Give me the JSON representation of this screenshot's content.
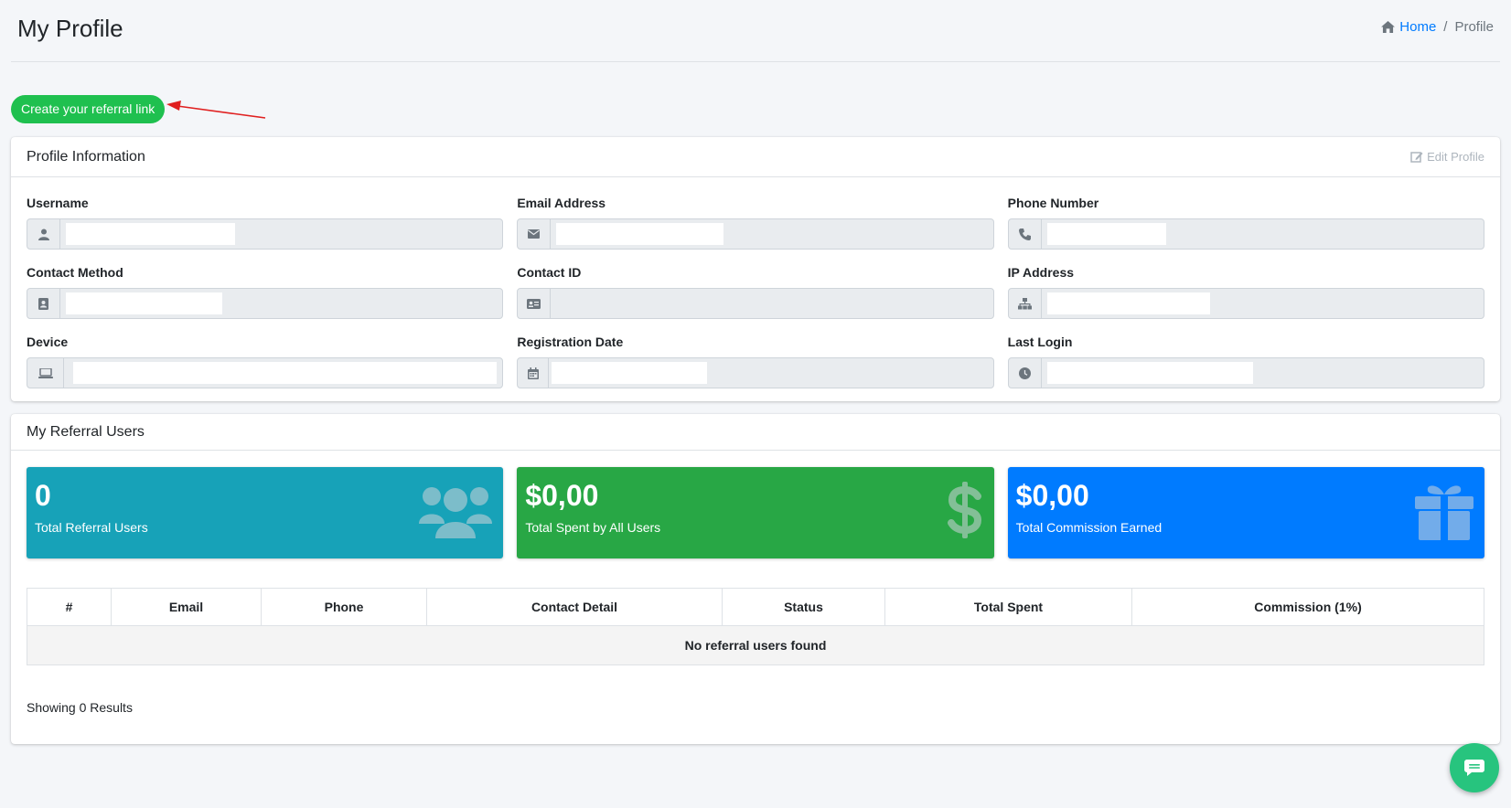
{
  "header": {
    "title": "My Profile",
    "breadcrumb": {
      "home": "Home",
      "separator": "/",
      "current": "Profile"
    }
  },
  "referral_button": {
    "label": "Create your referral link"
  },
  "profile_card": {
    "title": "Profile Information",
    "edit_label": "Edit Profile",
    "fields": {
      "username": {
        "label": "Username",
        "icon": "user-icon"
      },
      "email": {
        "label": "Email Address",
        "icon": "envelope-icon"
      },
      "phone": {
        "label": "Phone Number",
        "icon": "phone-icon"
      },
      "contact_method": {
        "label": "Contact Method",
        "icon": "address-book-icon"
      },
      "contact_id": {
        "label": "Contact ID",
        "icon": "id-card-icon"
      },
      "ip_address": {
        "label": "IP Address",
        "icon": "network-icon"
      },
      "device": {
        "label": "Device",
        "icon": "laptop-icon"
      },
      "registration_date": {
        "label": "Registration Date",
        "icon": "calendar-icon"
      },
      "last_login": {
        "label": "Last Login",
        "icon": "clock-icon"
      }
    }
  },
  "referral_card": {
    "title": "My Referral Users",
    "stats": [
      {
        "value": "0",
        "label": "Total Referral Users",
        "color": "#17a2b8",
        "icon": "users-icon"
      },
      {
        "value": "$0,00",
        "label": "Total Spent by All Users",
        "color": "#28a745",
        "icon": "dollar-icon"
      },
      {
        "value": "$0,00",
        "label": "Total Commission Earned",
        "color": "#007bff",
        "icon": "gift-icon"
      }
    ],
    "table": {
      "columns": [
        "#",
        "Email",
        "Phone",
        "Contact Detail",
        "Status",
        "Total Spent",
        "Commission (1%)"
      ],
      "empty_message": "No referral users found"
    },
    "results_text": "Showing 0 Results"
  },
  "colors": {
    "primary_link": "#007bff",
    "referral_button": "#1fc04f",
    "chat_button": "#27c47e"
  }
}
